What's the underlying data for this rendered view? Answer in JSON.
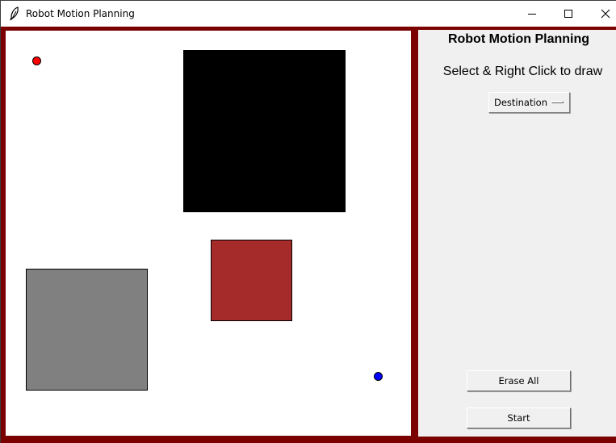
{
  "window": {
    "title": "Robot Motion Planning",
    "icon": "feather-icon",
    "controls": [
      "minimize-icon",
      "maximize-icon",
      "close-icon"
    ]
  },
  "panel": {
    "title": "Robot Motion Planning",
    "instructions": "Select & Right Click to draw",
    "draw_mode": {
      "selected": "Destination"
    },
    "buttons": {
      "erase_all": "Erase All",
      "start": "Start"
    }
  },
  "canvas": {
    "start_point": {
      "color": "#ff0000"
    },
    "destination_point": {
      "color": "#0000ff"
    },
    "obstacles": [
      {
        "color": "#000000"
      },
      {
        "color": "#a52a2a"
      },
      {
        "color": "#808080"
      }
    ]
  },
  "colors": {
    "frame": "#7b0000",
    "panel_background": "#f0f0f0",
    "canvas_background": "#ffffff"
  }
}
